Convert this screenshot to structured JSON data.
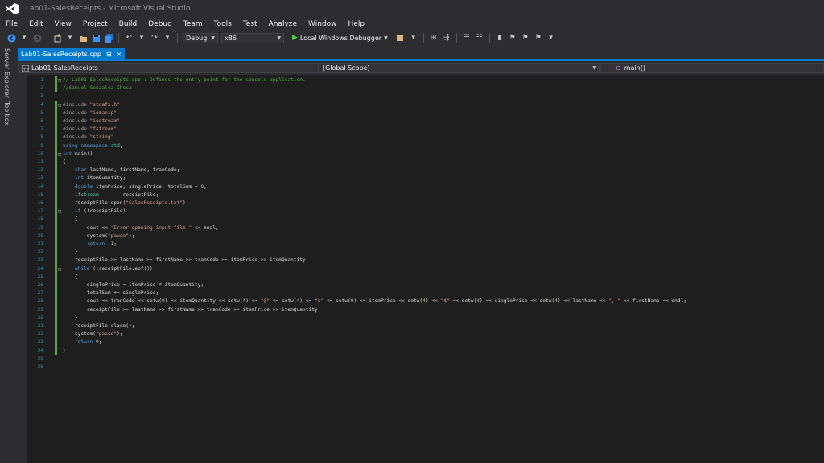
{
  "window": {
    "title": "Lab01-SalesReceipts - Microsoft Visual Studio"
  },
  "menu": [
    "File",
    "Edit",
    "View",
    "Project",
    "Build",
    "Debug",
    "Team",
    "Tools",
    "Test",
    "Analyze",
    "Window",
    "Help"
  ],
  "toolbar": {
    "configuration": "Debug",
    "platform": "x86",
    "debugger_label": "Local Windows Debugger"
  },
  "side_tabs": {
    "server_explorer": "Server Explorer",
    "toolbox": "Toolbox"
  },
  "document_tab": {
    "filename": "Lab01-SalesReceipts.cpp",
    "pin": "⊟",
    "close": "×"
  },
  "navigation": {
    "project": "Lab01-SalesReceipts",
    "scope": "(Global Scope)",
    "member": "main()"
  },
  "code": [
    {
      "n": "1",
      "t": "// Lab01-SalesReceipts.cpp : Defines the entry point for the console application."
    },
    {
      "n": "2",
      "t": "//Samuel Gonzalez Checa"
    },
    {
      "n": "3",
      "t": ""
    },
    {
      "n": "4",
      "t": "#include \"stdafx.h\""
    },
    {
      "n": "5",
      "t": "#include \"iomanip\""
    },
    {
      "n": "6",
      "t": "#include \"iostream\""
    },
    {
      "n": "7",
      "t": "#include \"fstream\""
    },
    {
      "n": "8",
      "t": "#include \"string\""
    },
    {
      "n": "9",
      "t": "using namespace std;"
    },
    {
      "n": "10",
      "t": "int main()"
    },
    {
      "n": "11",
      "t": "{"
    },
    {
      "n": "12",
      "t": "    char lastName, firstName, tranCode;"
    },
    {
      "n": "13",
      "t": "    int itemQuantity;"
    },
    {
      "n": "14",
      "t": "    double itemPrice, singlePrice, totalSum = 0;"
    },
    {
      "n": "15",
      "t": "    ifstream        receiptFile;"
    },
    {
      "n": "16",
      "t": "    receiptFile.open(\"SalesReceipts.txt\");"
    },
    {
      "n": "17",
      "t": "    if (!receiptFile)"
    },
    {
      "n": "18",
      "t": "    {"
    },
    {
      "n": "19",
      "t": "        cout << \"Error opening input file.\" << endl;"
    },
    {
      "n": "20",
      "t": "        system(\"pause\");"
    },
    {
      "n": "21",
      "t": "        return -1;"
    },
    {
      "n": "22",
      "t": "    }"
    },
    {
      "n": "23",
      "t": "    receiptFile >> lastName >> firstName >> tranCode >> itemPrice >> itemQuantity;"
    },
    {
      "n": "24",
      "t": "    while (!receiptFile.eof())"
    },
    {
      "n": "25",
      "t": "    {"
    },
    {
      "n": "26",
      "t": "        singlePrice = itemPrice * itemQuantity;"
    },
    {
      "n": "27",
      "t": "        totalSum += singlePrice;"
    },
    {
      "n": "28",
      "t": "        cout << tranCode << setw(9) << itemQuantity << setw(4) << \"@\" << setw(4) << \"$\" << setw(9) << itemPrice << setw(4) << \"$\" << setw(4) << singlePrice << setw(4) << lastName << \", \" << firstName << endl;"
    },
    {
      "n": "29",
      "t": "        receiptFile >> lastName >> firstName >> tranCode >> itemPrice >> itemQuantity;"
    },
    {
      "n": "30",
      "t": "    }"
    },
    {
      "n": "31",
      "t": "    receiptFile.close();"
    },
    {
      "n": "32",
      "t": "    system(\"pause\");"
    },
    {
      "n": "33",
      "t": "    return 0;"
    },
    {
      "n": "34",
      "t": "}"
    },
    {
      "n": "35",
      "t": ""
    },
    {
      "n": "36",
      "t": ""
    }
  ],
  "colors": {
    "accent": "#007acc",
    "editor_bg": "#1e1e1e",
    "chrome_bg": "#2d2d30",
    "line_numbers": "#2b91af",
    "comment": "#57a64a",
    "keyword": "#569cd6",
    "string": "#d69d85"
  }
}
